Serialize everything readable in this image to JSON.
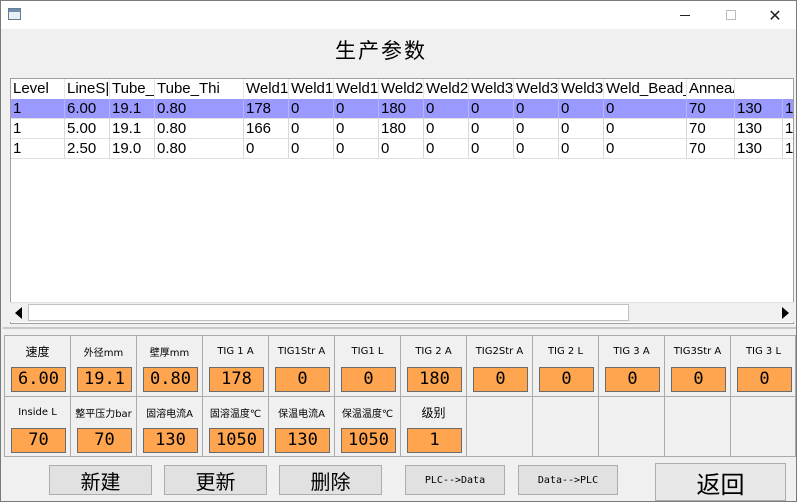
{
  "window": {
    "title_buttons": {
      "minimize": "—",
      "maximize": "☐",
      "close": "✕"
    }
  },
  "page_title": "生产参数",
  "grid": {
    "headers": [
      "Level",
      "LineS|",
      "Tube_",
      "Tube_Thi",
      "Weld1",
      "Weld1",
      "Weld1",
      "Weld2",
      "Weld2",
      "Weld3",
      "Weld3",
      "Weld3",
      "Weld_Bead_",
      "AnneaA",
      ""
    ],
    "rows": [
      [
        "1",
        "6.00",
        "19.1",
        "0.80",
        "178",
        "0",
        "0",
        "180",
        "0",
        "0",
        "0",
        "0",
        "0",
        "70",
        "130",
        "1"
      ],
      [
        "1",
        "5.00",
        "19.1",
        "0.80",
        "166",
        "0",
        "0",
        "180",
        "0",
        "0",
        "0",
        "0",
        "0",
        "70",
        "130",
        "1"
      ],
      [
        "1",
        "2.50",
        "19.0",
        "0.80",
        "0",
        "0",
        "0",
        "0",
        "0",
        "0",
        "0",
        "0",
        "0",
        "70",
        "130",
        "1"
      ]
    ],
    "selected_row": 0,
    "selected_color": "#9999ff"
  },
  "params": {
    "row1": [
      {
        "label": "速度",
        "value": "6.00"
      },
      {
        "label": "外径mm",
        "value": "19.1"
      },
      {
        "label": "壁厚mm",
        "value": "0.80"
      },
      {
        "label": "TIG 1 A",
        "value": "178"
      },
      {
        "label": "TIG1Str A",
        "value": "0"
      },
      {
        "label": "TIG1 L",
        "value": "0"
      },
      {
        "label": "TIG 2 A",
        "value": "180"
      },
      {
        "label": "TIG2Str A",
        "value": "0"
      },
      {
        "label": "TIG 2 L",
        "value": "0"
      },
      {
        "label": "TIG 3 A",
        "value": "0"
      },
      {
        "label": "TIG3Str A",
        "value": "0"
      },
      {
        "label": "TIG 3 L",
        "value": "0"
      }
    ],
    "row2": [
      {
        "label": "Inside L",
        "value": "70"
      },
      {
        "label": "整平压力bar",
        "value": "70"
      },
      {
        "label": "固溶电流A",
        "value": "130"
      },
      {
        "label": "固溶温度℃",
        "value": "1050"
      },
      {
        "label": "保温电流A",
        "value": "130"
      },
      {
        "label": "保温温度℃",
        "value": "1050"
      },
      {
        "label": "级别",
        "value": "1"
      }
    ],
    "value_color": "#ffa54f"
  },
  "buttons": {
    "new": "新建",
    "update": "更新",
    "delete": "删除",
    "plc_to_data": "PLC-->Data",
    "data_to_plc": "Data-->PLC",
    "back": "返回"
  }
}
